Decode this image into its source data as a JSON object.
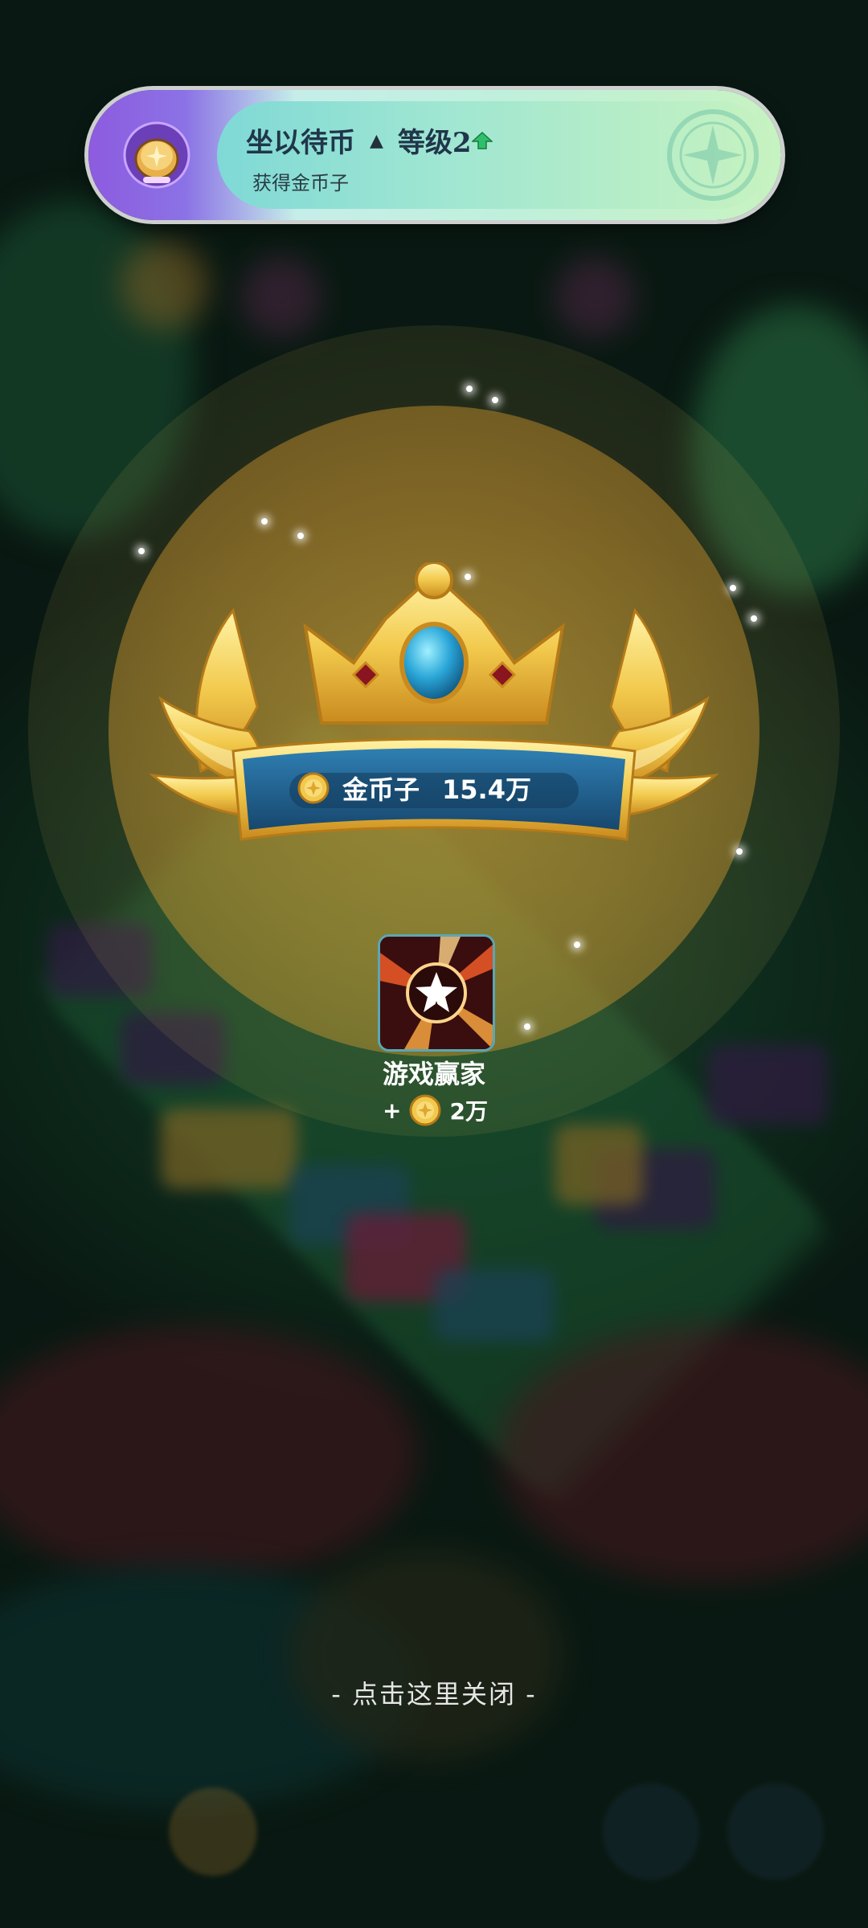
{
  "banner": {
    "title": "坐以待币",
    "level_arrow": "▲",
    "level": "等级2",
    "subtitle": "获得金币子"
  },
  "reward": {
    "currency_label": "金币子",
    "amount": "15.4万"
  },
  "achievement": {
    "name": "游戏赢家",
    "bonus_prefix": "+",
    "bonus_amount": "2万"
  },
  "close_hint": "- 点击这里关闭 -",
  "colors": {
    "gold": "#f2c94c",
    "ribbon_blue": "#1f5f8f",
    "banner_purple": "#8d5bdf",
    "banner_mint": "#bff0dc"
  },
  "icons": {
    "banner_badge": "gold-coin-badge-icon",
    "level_up": "green-up-arrow-icon",
    "banner_star": "star-emblem-icon",
    "coin": "coin-icon",
    "achievement": "star-burst-achievement-icon"
  }
}
